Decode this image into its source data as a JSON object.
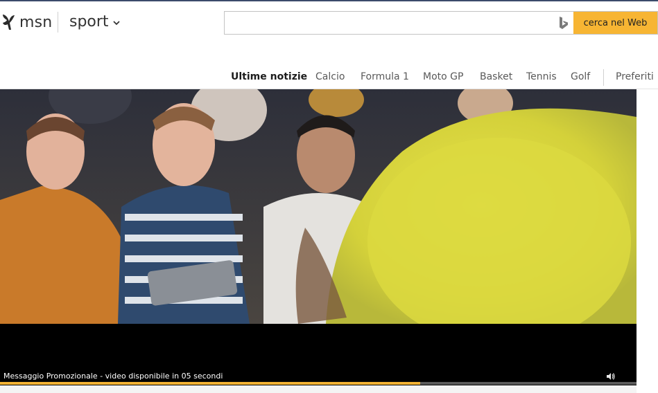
{
  "brand": {
    "name": "msn"
  },
  "section": {
    "label": "sport"
  },
  "search": {
    "value": "",
    "placeholder": "",
    "button_label": "cerca nel Web"
  },
  "nav": {
    "items": [
      {
        "label": "Ultime notizie",
        "active": true
      },
      {
        "label": "Calcio",
        "active": false
      },
      {
        "label": "Formula 1",
        "active": false
      },
      {
        "label": "Moto GP",
        "active": false
      },
      {
        "label": "Basket",
        "active": false
      },
      {
        "label": "Tennis",
        "active": false
      },
      {
        "label": "Golf",
        "active": false
      },
      {
        "label": "Preferiti",
        "active": false
      }
    ]
  },
  "player": {
    "message": "Messaggio Promozionale - video disponibile in 05 secondi",
    "progress": 0.66,
    "progress_color": "#f2b233"
  },
  "colors": {
    "accent": "#f7b533",
    "header_line": "#3b4a6b"
  },
  "icons": {
    "logo": "msn-butterfly-icon",
    "chevron": "chevron-down-icon",
    "bing": "bing-icon",
    "volume": "volume-icon"
  }
}
